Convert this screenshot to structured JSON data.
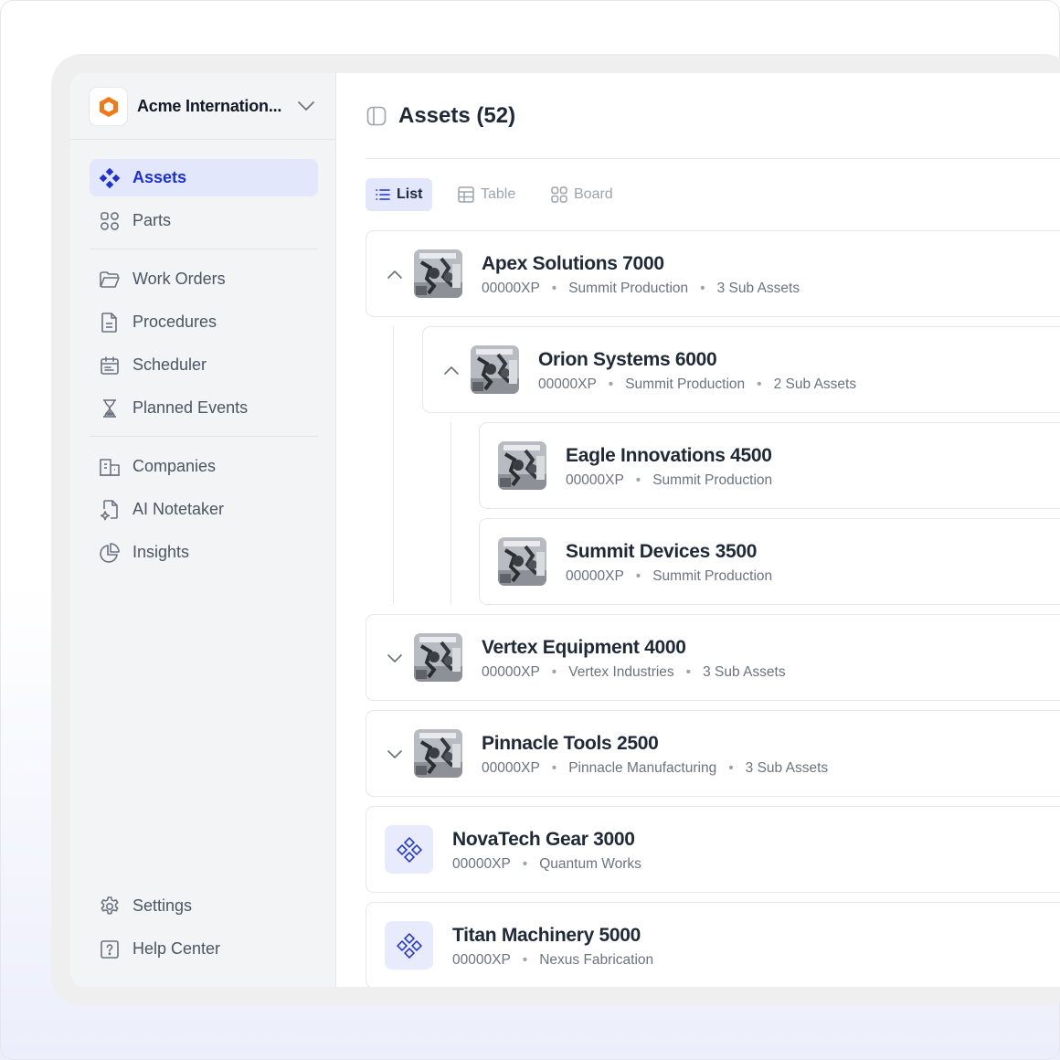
{
  "org": {
    "name": "Acme Internation..."
  },
  "sidebar": {
    "items": [
      {
        "label": "Assets",
        "icon": "assets-icon",
        "active": true
      },
      {
        "label": "Parts",
        "icon": "parts-icon"
      },
      {
        "label": "Work Orders",
        "icon": "folder-icon"
      },
      {
        "label": "Procedures",
        "icon": "document-icon"
      },
      {
        "label": "Scheduler",
        "icon": "calendar-icon"
      },
      {
        "label": "Planned Events",
        "icon": "hourglass-icon"
      },
      {
        "label": "Companies",
        "icon": "building-icon"
      },
      {
        "label": "AI Notetaker",
        "icon": "ai-notetaker-icon"
      },
      {
        "label": "Insights",
        "icon": "pie-chart-icon"
      }
    ],
    "footer": [
      {
        "label": "Settings",
        "icon": "gear-icon"
      },
      {
        "label": "Help Center",
        "icon": "help-icon"
      }
    ]
  },
  "header": {
    "title": "Assets (52)"
  },
  "view_tabs": [
    {
      "label": "List",
      "active": true
    },
    {
      "label": "Table"
    },
    {
      "label": "Board"
    }
  ],
  "assets": [
    {
      "name": "Apex Solutions 7000",
      "code": "00000XP",
      "location": "Summit Production",
      "sub": "3 Sub Assets",
      "expanded": true
    },
    {
      "name": "Orion Systems 6000",
      "code": "00000XP",
      "location": "Summit Production",
      "sub": "2 Sub Assets",
      "expanded": true
    },
    {
      "name": "Eagle Innovations 4500",
      "code": "00000XP",
      "location": "Summit Production"
    },
    {
      "name": "Summit Devices 3500",
      "code": "00000XP",
      "location": "Summit Production"
    },
    {
      "name": "Vertex Equipment 4000",
      "code": "00000XP",
      "location": "Vertex Industries",
      "sub": "3 Sub Assets",
      "expanded": false
    },
    {
      "name": "Pinnacle Tools 2500",
      "code": "00000XP",
      "location": "Pinnacle Manufacturing",
      "sub": "3 Sub Assets",
      "expanded": false
    },
    {
      "name": "NovaTech Gear 3000",
      "code": "00000XP",
      "location": "Quantum Works"
    },
    {
      "name": "Titan Machinery 5000",
      "code": "00000XP",
      "location": "Nexus Fabrication"
    }
  ],
  "colors": {
    "accent": "#1d2fd6",
    "accent_bg": "#e3e7fc",
    "logo": "#f07a1a"
  }
}
